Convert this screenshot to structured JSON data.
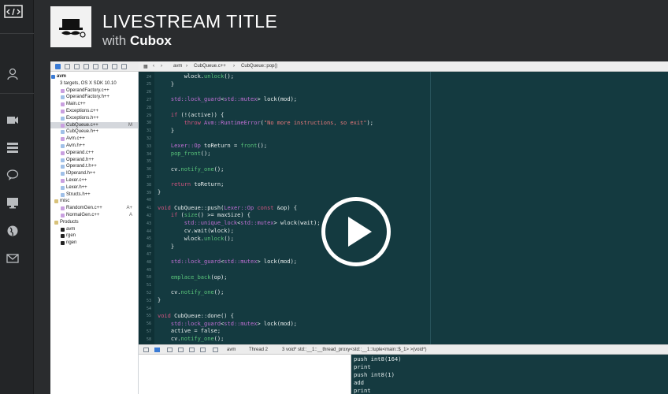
{
  "stream": {
    "title": "LIVESTREAM TITLE",
    "with": "with",
    "brand": "Cubox"
  },
  "rail": [
    {
      "icon": "code-icon"
    },
    {
      "icon": "user-icon"
    },
    {
      "icon": "video-icon"
    },
    {
      "icon": "list-icon"
    },
    {
      "icon": "chat-icon"
    },
    {
      "icon": "monitor-icon"
    },
    {
      "icon": "globe-icon"
    },
    {
      "icon": "mail-icon"
    }
  ],
  "navigator": {
    "project": "avm",
    "project_sub": "3 targets, OS X SDK 10.10",
    "files": [
      {
        "name": "OperandFactory.c++",
        "type": "cpp"
      },
      {
        "name": "OperandFactory.h++",
        "type": "h"
      },
      {
        "name": "Main.c++",
        "type": "cpp"
      },
      {
        "name": "Exceptions.c++",
        "type": "cpp"
      },
      {
        "name": "Exceptions.h++",
        "type": "h"
      },
      {
        "name": "CubQueue.c++",
        "type": "cpp",
        "badge": "M",
        "selected": true
      },
      {
        "name": "CubQueue.h++",
        "type": "h"
      },
      {
        "name": "Avm.c++",
        "type": "cpp"
      },
      {
        "name": "Avm.h++",
        "type": "h"
      },
      {
        "name": "Operand.c++",
        "type": "cpp"
      },
      {
        "name": "Operand.h++",
        "type": "h"
      },
      {
        "name": "Operand.t.h++",
        "type": "h"
      },
      {
        "name": "IOperand.h++",
        "type": "h"
      },
      {
        "name": "Lexer.c++",
        "type": "cpp"
      },
      {
        "name": "Lexer.h++",
        "type": "h"
      },
      {
        "name": "Structs.h++",
        "type": "h"
      }
    ],
    "misc_label": "misc",
    "misc": [
      {
        "name": "RandomGen.c++",
        "badge": "A+"
      },
      {
        "name": "NormalGen.c++",
        "badge": "A"
      }
    ],
    "products_label": "Products",
    "products": [
      "avm",
      "rgen",
      "ngen"
    ]
  },
  "jumpbar": {
    "project": "avm",
    "file": "CubQueue.c++",
    "symbol": "CubQueue::pop()"
  },
  "code": {
    "lines": [
      {
        "n": "24",
        "t": "        wlock.unlock();"
      },
      {
        "n": "25",
        "t": "    }"
      },
      {
        "n": "26",
        "t": ""
      },
      {
        "n": "27",
        "t": "    std::lock_guard<std::mutex> lock(mod);"
      },
      {
        "n": "28",
        "t": ""
      },
      {
        "n": "29",
        "t": "    if (!(active)) {"
      },
      {
        "n": "30",
        "t": "        throw Avm::RuntimeError(\"No more instructions, so exit\");"
      },
      {
        "n": "31",
        "t": "    }"
      },
      {
        "n": "32",
        "t": ""
      },
      {
        "n": "33",
        "t": "    Lexer::Op toReturn = front();"
      },
      {
        "n": "34",
        "t": "    pop_front();"
      },
      {
        "n": "35",
        "t": ""
      },
      {
        "n": "36",
        "t": "    cv.notify_one();"
      },
      {
        "n": "37",
        "t": ""
      },
      {
        "n": "38",
        "t": "    return toReturn;"
      },
      {
        "n": "39",
        "t": "}"
      },
      {
        "n": "40",
        "t": ""
      },
      {
        "n": "41",
        "t": "void CubQueue::push(Lexer::Op const &op) {"
      },
      {
        "n": "42",
        "t": "    if (size() >= maxSize) {"
      },
      {
        "n": "43",
        "t": "        std::unique_lock<std::mutex> wlock(wait);"
      },
      {
        "n": "44",
        "t": "        cv.wait(wlock);"
      },
      {
        "n": "45",
        "t": "        wlock.unlock();"
      },
      {
        "n": "46",
        "t": "    }"
      },
      {
        "n": "47",
        "t": ""
      },
      {
        "n": "48",
        "t": "    std::lock_guard<std::mutex> lock(mod);"
      },
      {
        "n": "49",
        "t": ""
      },
      {
        "n": "50",
        "t": "    emplace_back(op);"
      },
      {
        "n": "51",
        "t": ""
      },
      {
        "n": "52",
        "t": "    cv.notify_one();"
      },
      {
        "n": "53",
        "t": "}"
      },
      {
        "n": "54",
        "t": ""
      },
      {
        "n": "55",
        "t": "void CubQueue::done() {"
      },
      {
        "n": "56",
        "t": "    std::lock_guard<std::mutex> lock(mod);"
      },
      {
        "n": "57",
        "t": "    active = false;"
      },
      {
        "n": "58",
        "t": "    cv.notify_one();"
      }
    ]
  },
  "debugbar": {
    "target": "avm",
    "thread": "Thread 2",
    "frame": "3 void* std::__1::__thread_proxy<std::__1::tuple<main::$_1> >(void*)"
  },
  "console": {
    "lines": [
      "push int8(164)",
      "print",
      "push int8(1)",
      "add",
      "print"
    ]
  },
  "colors": {
    "editor_bg": "#153a40",
    "keyword": "#d3547f",
    "type": "#c06fd4",
    "function": "#59c47a",
    "string": "#e7787a"
  },
  "overlay": {
    "icon": "play-icon"
  }
}
